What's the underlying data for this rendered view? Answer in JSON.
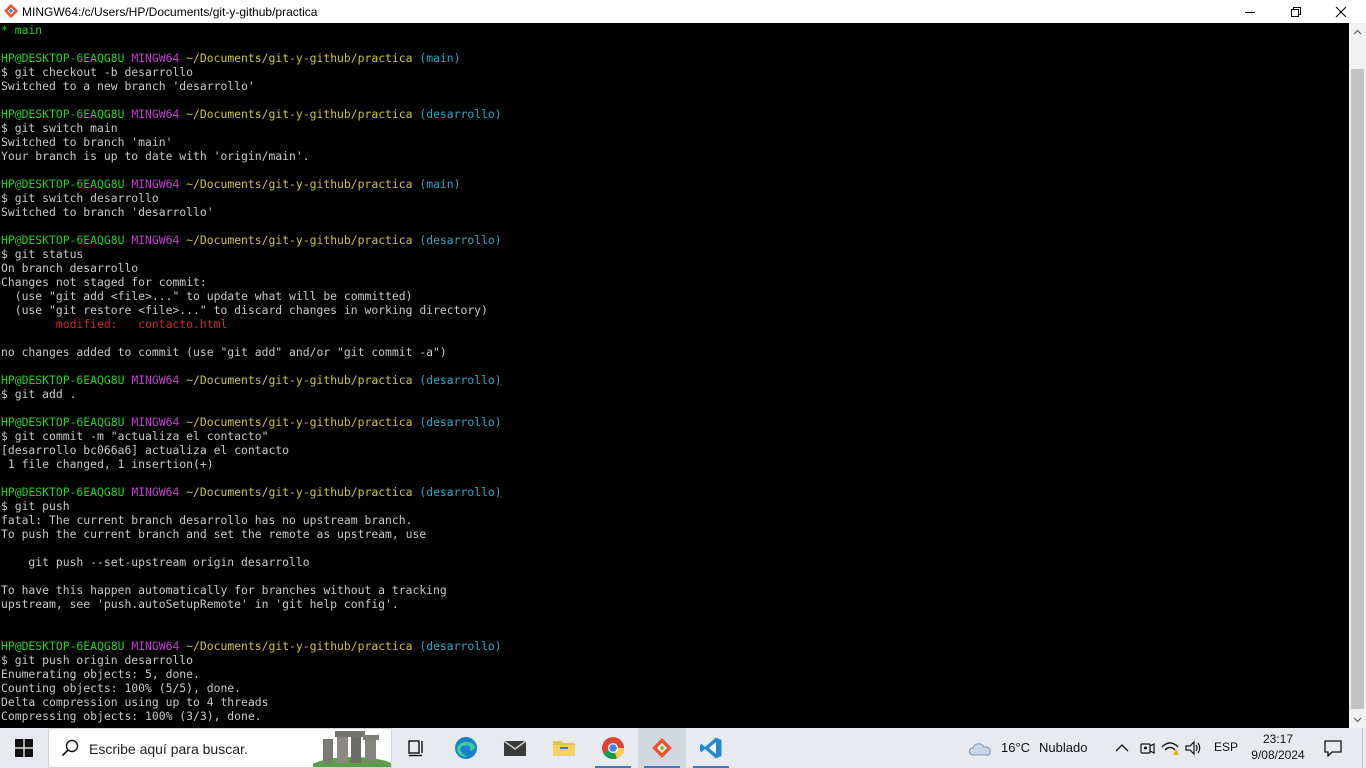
{
  "window": {
    "title": "MINGW64:/c/Users/HP/Documents/git-y-github/practica"
  },
  "terminal": {
    "lines": [
      [
        {
          "t": "* main",
          "c": "green"
        }
      ],
      [],
      [
        {
          "t": "HP@DESKTOP-6EAQG8U",
          "c": "green"
        },
        {
          "t": " ",
          "c": "white"
        },
        {
          "t": "MINGW64",
          "c": "magenta"
        },
        {
          "t": " ",
          "c": "white"
        },
        {
          "t": "~/Documents/git-y-github/practica",
          "c": "yellow"
        },
        {
          "t": " (main)",
          "c": "cyan"
        }
      ],
      [
        {
          "t": "$ git checkout -b desarrollo",
          "c": "white"
        }
      ],
      [
        {
          "t": "Switched to a new branch 'desarrollo'",
          "c": "white"
        }
      ],
      [],
      [
        {
          "t": "HP@DESKTOP-6EAQG8U",
          "c": "green"
        },
        {
          "t": " ",
          "c": "white"
        },
        {
          "t": "MINGW64",
          "c": "magenta"
        },
        {
          "t": " ",
          "c": "white"
        },
        {
          "t": "~/Documents/git-y-github/practica",
          "c": "yellow"
        },
        {
          "t": " (desarrollo)",
          "c": "cyan"
        }
      ],
      [
        {
          "t": "$ git switch main",
          "c": "white"
        }
      ],
      [
        {
          "t": "Switched to branch 'main'",
          "c": "white"
        }
      ],
      [
        {
          "t": "Your branch is up to date with 'origin/main'.",
          "c": "white"
        }
      ],
      [],
      [
        {
          "t": "HP@DESKTOP-6EAQG8U",
          "c": "green"
        },
        {
          "t": " ",
          "c": "white"
        },
        {
          "t": "MINGW64",
          "c": "magenta"
        },
        {
          "t": " ",
          "c": "white"
        },
        {
          "t": "~/Documents/git-y-github/practica",
          "c": "yellow"
        },
        {
          "t": " (main)",
          "c": "cyan"
        }
      ],
      [
        {
          "t": "$ git switch desarrollo",
          "c": "white"
        }
      ],
      [
        {
          "t": "Switched to branch 'desarrollo'",
          "c": "white"
        }
      ],
      [],
      [
        {
          "t": "HP@DESKTOP-6EAQG8U",
          "c": "green"
        },
        {
          "t": " ",
          "c": "white"
        },
        {
          "t": "MINGW64",
          "c": "magenta"
        },
        {
          "t": " ",
          "c": "white"
        },
        {
          "t": "~/Documents/git-y-github/practica",
          "c": "yellow"
        },
        {
          "t": " (desarrollo)",
          "c": "cyan"
        }
      ],
      [
        {
          "t": "$ git status",
          "c": "white"
        }
      ],
      [
        {
          "t": "On branch desarrollo",
          "c": "white"
        }
      ],
      [
        {
          "t": "Changes not staged for commit:",
          "c": "white"
        }
      ],
      [
        {
          "t": "  (use \"git add <file>...\" to update what will be committed)",
          "c": "white"
        }
      ],
      [
        {
          "t": "  (use \"git restore <file>...\" to discard changes in working directory)",
          "c": "white"
        }
      ],
      [
        {
          "t": "        modified:   contacto.html",
          "c": "red"
        }
      ],
      [],
      [
        {
          "t": "no changes added to commit (use \"git add\" and/or \"git commit -a\")",
          "c": "white"
        }
      ],
      [],
      [
        {
          "t": "HP@DESKTOP-6EAQG8U",
          "c": "green"
        },
        {
          "t": " ",
          "c": "white"
        },
        {
          "t": "MINGW64",
          "c": "magenta"
        },
        {
          "t": " ",
          "c": "white"
        },
        {
          "t": "~/Documents/git-y-github/practica",
          "c": "yellow"
        },
        {
          "t": " (desarrollo)",
          "c": "cyan"
        }
      ],
      [
        {
          "t": "$ git add .",
          "c": "white"
        }
      ],
      [],
      [
        {
          "t": "HP@DESKTOP-6EAQG8U",
          "c": "green"
        },
        {
          "t": " ",
          "c": "white"
        },
        {
          "t": "MINGW64",
          "c": "magenta"
        },
        {
          "t": " ",
          "c": "white"
        },
        {
          "t": "~/Documents/git-y-github/practica",
          "c": "yellow"
        },
        {
          "t": " (desarrollo)",
          "c": "cyan"
        }
      ],
      [
        {
          "t": "$ git commit -m \"actualiza el contacto\"",
          "c": "white"
        }
      ],
      [
        {
          "t": "[desarrollo bc066a6] actualiza el contacto",
          "c": "white"
        }
      ],
      [
        {
          "t": " 1 file changed, 1 insertion(+)",
          "c": "white"
        }
      ],
      [],
      [
        {
          "t": "HP@DESKTOP-6EAQG8U",
          "c": "green"
        },
        {
          "t": " ",
          "c": "white"
        },
        {
          "t": "MINGW64",
          "c": "magenta"
        },
        {
          "t": " ",
          "c": "white"
        },
        {
          "t": "~/Documents/git-y-github/practica",
          "c": "yellow"
        },
        {
          "t": " (desarrollo)",
          "c": "cyan"
        }
      ],
      [
        {
          "t": "$ git push",
          "c": "white"
        }
      ],
      [
        {
          "t": "fatal: The current branch desarrollo has no upstream branch.",
          "c": "white"
        }
      ],
      [
        {
          "t": "To push the current branch and set the remote as upstream, use",
          "c": "white"
        }
      ],
      [],
      [
        {
          "t": "    git push --set-upstream origin desarrollo",
          "c": "white"
        }
      ],
      [],
      [
        {
          "t": "To have this happen automatically for branches without a tracking",
          "c": "white"
        }
      ],
      [
        {
          "t": "upstream, see 'push.autoSetupRemote' in 'git help config'.",
          "c": "white"
        }
      ],
      [],
      [],
      [
        {
          "t": "HP@DESKTOP-6EAQG8U",
          "c": "green"
        },
        {
          "t": " ",
          "c": "white"
        },
        {
          "t": "MINGW64",
          "c": "magenta"
        },
        {
          "t": " ",
          "c": "white"
        },
        {
          "t": "~/Documents/git-y-github/practica",
          "c": "yellow"
        },
        {
          "t": " (desarrollo)",
          "c": "cyan"
        }
      ],
      [
        {
          "t": "$ git push origin desarrollo",
          "c": "white"
        }
      ],
      [
        {
          "t": "Enumerating objects: 5, done.",
          "c": "white"
        }
      ],
      [
        {
          "t": "Counting objects: 100% (5/5), done.",
          "c": "white"
        }
      ],
      [
        {
          "t": "Delta compression using up to 4 threads",
          "c": "white"
        }
      ],
      [
        {
          "t": "Compressing objects: 100% (3/3), done.",
          "c": "white"
        }
      ]
    ]
  },
  "taskbar": {
    "search_placeholder": "Escribe aquí para buscar.",
    "apps": [
      {
        "name": "task-view",
        "icon": "task-view-icon",
        "running": false
      },
      {
        "name": "edge",
        "icon": "edge-icon",
        "running": false
      },
      {
        "name": "mail",
        "icon": "mail-icon",
        "running": false
      },
      {
        "name": "file-explorer",
        "icon": "folder-icon",
        "running": false
      },
      {
        "name": "chrome",
        "icon": "chrome-icon",
        "running": true
      },
      {
        "name": "git-bash",
        "icon": "git-icon",
        "running": true
      },
      {
        "name": "vscode",
        "icon": "vscode-icon",
        "running": true
      }
    ],
    "weather": {
      "temp": "16°C",
      "condition": "Nublado"
    },
    "language": "ESP",
    "time": "23:17",
    "date": "9/08/2024"
  },
  "colors": {
    "prompt_user": "#1ad31a",
    "prompt_system": "#c33bd0",
    "prompt_path": "#c8c43c",
    "prompt_branch": "#2ba8c0",
    "modified": "#d3282b",
    "text": "#c8c8c8"
  }
}
